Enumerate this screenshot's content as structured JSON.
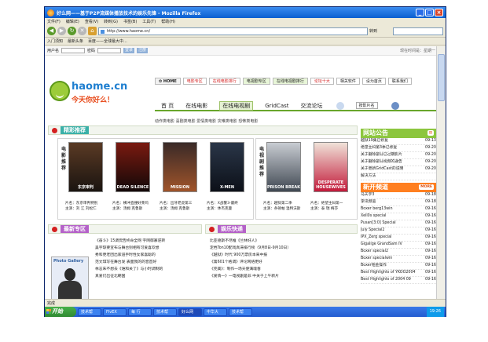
{
  "window": {
    "title": "好么网——基于P2P流媒体播放技术的娱乐先锋 - Mozilla Firefox"
  },
  "menu": [
    "文件(F)",
    "编辑(E)",
    "查看(V)",
    "转到(G)",
    "书签(B)",
    "工具(T)",
    "帮助(H)"
  ],
  "nav": {
    "url": "http://www.haome.cn/",
    "go_label": "转到"
  },
  "bookmarks": [
    "入门须知",
    "最新头条",
    "百度——全球最大中..."
  ],
  "site": {
    "topline": {
      "user_label": "用户名",
      "pass_label": "密码",
      "login": "登录",
      "register": "注册",
      "right_text": "现在时间是：星期一"
    },
    "logo": {
      "domain": "haome.cn",
      "slogan": "今天你好么！"
    },
    "top_tabs": [
      "✿ HOME",
      "电影专区",
      "在线电影排行",
      "电视剧专区",
      "在线电视剧排行",
      "论坛十大",
      "相关软件",
      "设为首页",
      "联系我们"
    ],
    "main_nav": [
      "首 页",
      "在线电影",
      "在线电视剧",
      "GridCast",
      "交流论坛"
    ],
    "search_select": "按影片名",
    "categories": "动作类电影 喜剧类电影 爱情类电影 灾难类电影 恐怖类电影",
    "recommend_title": "精彩推荐",
    "movie_label": "电影推荐",
    "tv_label": "电视剧推荐",
    "movies": [
      {
        "poster": "东京审判",
        "name": "片名：东京审判特别",
        "star": "主演：刘 江 刘松仁"
      },
      {
        "poster": "DEAD SILENCE",
        "name": "片名：横冲直撞好莱坞",
        "star": "主演：汤姆 克鲁斯"
      },
      {
        "poster": "MISSION",
        "name": "片名：出牙老虎第三",
        "star": "主演：汤姆 克鲁斯"
      },
      {
        "poster": "X-MEN",
        "name": "片名：X战警3-最终",
        "star": "主演：休杰克曼"
      }
    ],
    "tv": [
      {
        "poster": "PRISON BREAK",
        "name": "片名：越狱第二季",
        "star": "主演：条顿帕 温特沃斯"
      },
      {
        "poster": "DESPERATE HOUSEWIVES",
        "name": "片名：绝望主妇第一",
        "star": "主演：泰 瑞 梅莎"
      }
    ],
    "notice": {
      "title": "网站公告",
      "items": [
        {
          "text": "越狱19集已修复",
          "date": "09-13"
        },
        {
          "text": "绝望主妇第3季已修复",
          "date": "09-20"
        },
        {
          "text": "关于删除部分已过期影片",
          "date": "09-20"
        },
        {
          "text": "关于删除部分视频的通告",
          "date": "09-20"
        },
        {
          "text": "关于更新GridCast的说明",
          "date": "09-20"
        },
        {
          "text": "解决方法",
          "date": ""
        }
      ]
    },
    "new_channel": {
      "title": "新开频道",
      "more": "MORE",
      "items": [
        {
          "text": "马天宇3",
          "date": "09-18"
        },
        {
          "text": "李讯频道",
          "date": "09-18"
        },
        {
          "text": "Boxer berg13win",
          "date": "09-16"
        },
        {
          "text": "Xell0s special",
          "date": "09-16"
        },
        {
          "text": "Pusan[3:0] Special",
          "date": "09-16"
        },
        {
          "text": "July Special2",
          "date": "09-16"
        },
        {
          "text": "IPX_Zerg special",
          "date": "09-16"
        },
        {
          "text": "Gigalige GrandSam IV",
          "date": "09-16"
        },
        {
          "text": "Boxer special2",
          "date": "09-16"
        },
        {
          "text": "Boxer specialwin",
          "date": "09-16"
        },
        {
          "text": "Boxer铂金操作",
          "date": "09-16"
        },
        {
          "text": "Best Highlights of YKOO2004",
          "date": "09-16"
        },
        {
          "text": "Best Highlights of 2004 09",
          "date": "09-16"
        }
      ]
    },
    "hot_title": "最新专区",
    "hot_items": [
      "《奋斗》15调侃告终命全网 字网郁寡逆转",
      "吴宇琼要宣布与舞台别相有可爱喜欢想",
      "秀和更老团出家道手时性女家喜聪的",
      "范文琪写在舞台发 表面我的的音首好",
      "林志朱不想去《谁和关了》与小时调制的",
      "真爱们出征北朝国"
    ],
    "photo_caption": "Photo Gallery",
    "ent_title": "娱乐快递",
    "ent_items": [
      "比亚德斯不尽推《兰林好人》",
      "定档Ton10配戏真滞排行榜（9月8日-9月10日）",
      "《越狱》时代 900万票房本来中报",
      "《第601个格调》评论网络更好",
      "《完美》：制作一场天使满魂春",
      "《爱情一》一电视剧是非 中关于上午新片"
    ],
    "status": "完成",
    "taskbar": {
      "start": "开始",
      "items": [
        "技术帮",
        "FlvEX",
        "每 行",
        "技术帮",
        "好么网",
        "中华大",
        "技术帮"
      ],
      "clock": "19:26"
    }
  }
}
